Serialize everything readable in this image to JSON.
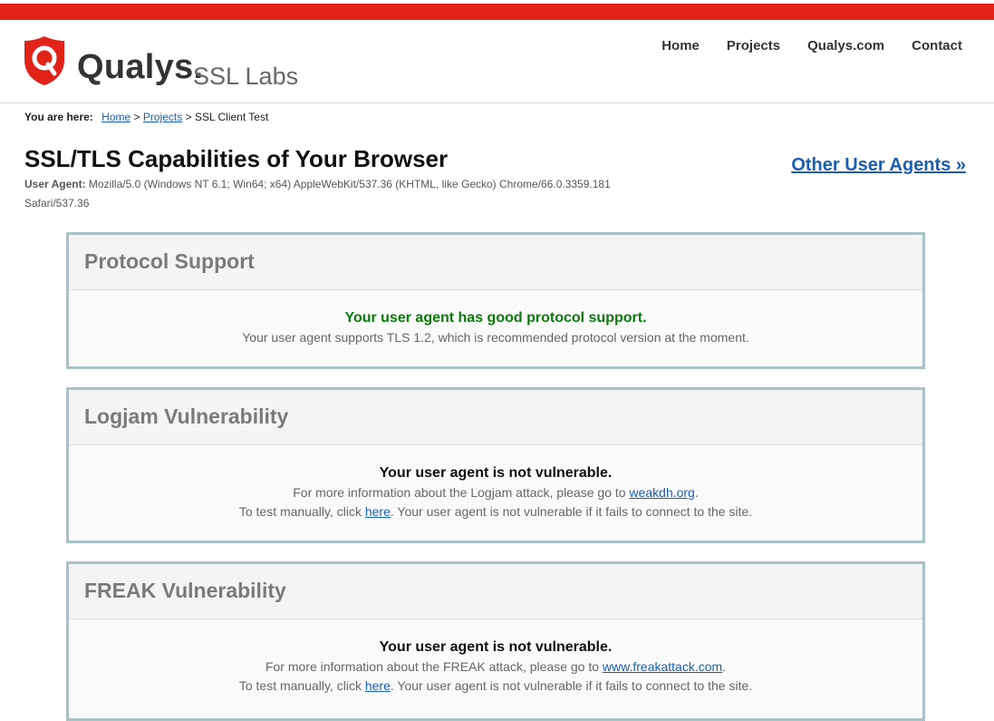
{
  "brand": {
    "name": "Qualys.",
    "product": "SSL Labs",
    "accent_color": "#e2231a",
    "logo_icon": "shield-q-icon"
  },
  "nav": {
    "items": [
      {
        "label": "Home"
      },
      {
        "label": "Projects"
      },
      {
        "label": "Qualys.com"
      },
      {
        "label": "Contact"
      }
    ]
  },
  "breadcrumb": {
    "prefix": "You are here:",
    "items": [
      {
        "label": "Home"
      },
      {
        "label": "Projects"
      }
    ],
    "separator": ">",
    "current": "SSL Client Test"
  },
  "page": {
    "title": "SSL/TLS Capabilities of Your Browser",
    "user_agent_label": "User Agent:",
    "user_agent": "Mozilla/5.0 (Windows NT 6.1; Win64; x64) AppleWebKit/537.36 (KHTML, like Gecko) Chrome/66.0.3359.181 Safari/537.36",
    "other_agents_link": "Other User Agents »"
  },
  "panels": [
    {
      "title": "Protocol Support",
      "status": "Your user agent has good protocol support.",
      "status_color": "#0b7a0b",
      "line1": "Your user agent supports TLS 1.2, which is recommended protocol version at the moment."
    },
    {
      "title": "Logjam Vulnerability",
      "status": "Your user agent is not vulnerable.",
      "info_prefix": "For more information about the Logjam attack, please go to",
      "info_link": "weakdh.org",
      "test_prefix": "To test manually, click",
      "test_link": "here",
      "test_suffix": ". Your user agent is not vulnerable if it fails to connect to the site."
    },
    {
      "title": "FREAK Vulnerability",
      "status": "Your user agent is not vulnerable.",
      "info_prefix": "For more information about the FREAK attack, please go to",
      "info_link": "www.freakattack.com",
      "test_prefix": "To test manually, click",
      "test_link": "here",
      "test_suffix": ". Your user agent is not vulnerable if it fails to connect to the site."
    }
  ]
}
